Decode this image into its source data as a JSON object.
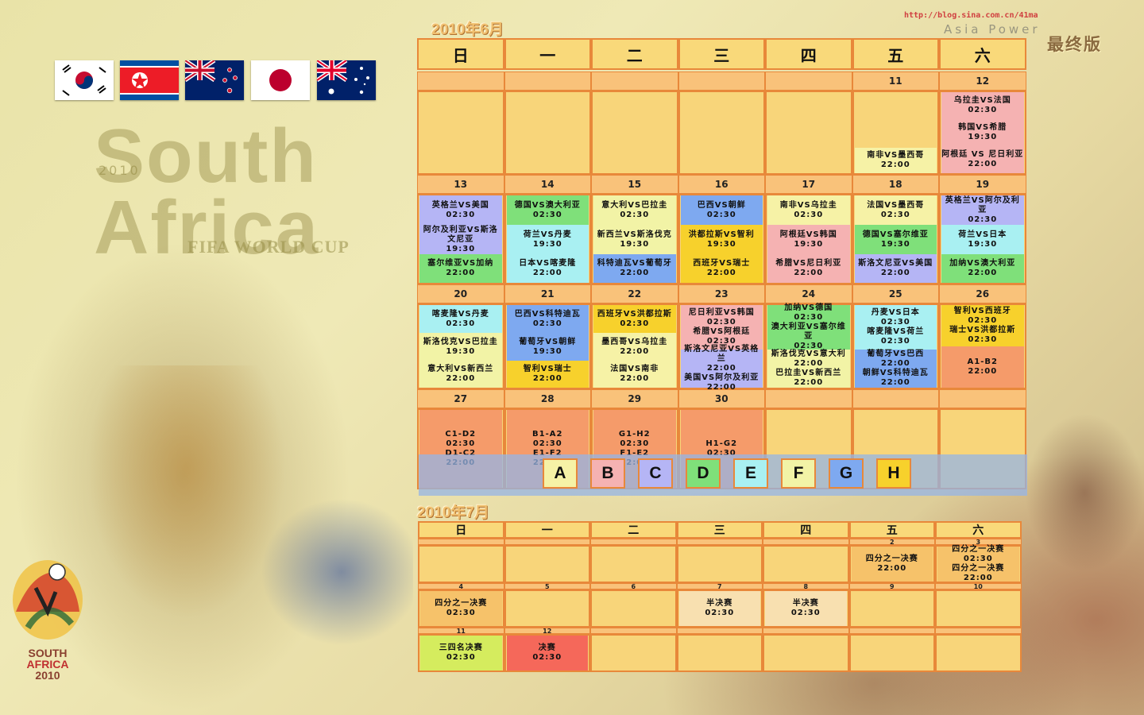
{
  "watermark": {
    "url": "http://blog.sina.com.cn/41ma",
    "brand": "Asia Power",
    "edition": "最终版"
  },
  "flags": [
    "south-korea-flag",
    "north-korea-flag",
    "new-zealand-flag",
    "japan-flag",
    "australia-flag"
  ],
  "branding": {
    "year": "2010",
    "line1": "South",
    "line2": "Africa",
    "cup": "FIFA WORLD CUP",
    "logo_line1": "SOUTH",
    "logo_line2": "AFRICA",
    "logo_line3": "2010"
  },
  "colors": {
    "A": "#f6f2a6",
    "B": "#f5b2b2",
    "C": "#b5b5f5",
    "D": "#7fe07a",
    "E": "#a9f0f2",
    "F": "#f2f3a6",
    "G": "#7ea9f0",
    "H": "#f7d12c",
    "knockout16": "#f59b6a",
    "quarter": "#f6c26a",
    "semi": "#f8e0b0",
    "third": "#d5ec5e",
    "final": "#f5685a",
    "empty": "#f8d57a",
    "border": "#e8883a"
  },
  "june": {
    "title": "2010年6月",
    "weekdays": [
      "日",
      "一",
      "二",
      "三",
      "四",
      "五",
      "六"
    ],
    "weeks": [
      {
        "dates": [
          "",
          "",
          "",
          "",
          "",
          "11",
          "12"
        ],
        "cells": [
          [],
          [],
          [],
          [],
          [],
          [
            {
              "g": "A",
              "t": "南非VS墨西哥",
              "time": "22:00"
            }
          ],
          [
            {
              "g": "B",
              "t": "乌拉圭VS法国",
              "time": "02:30"
            },
            {
              "g": "B",
              "t": "韩国VS希腊",
              "time": "19:30"
            },
            {
              "g": "B",
              "t": "阿根廷 VS 尼日利亚",
              "time": "22:00"
            }
          ]
        ]
      },
      {
        "dates": [
          "13",
          "14",
          "15",
          "16",
          "17",
          "18",
          "19"
        ],
        "cells": [
          [
            {
              "g": "C",
              "t": "英格兰VS美国",
              "time": "02:30"
            },
            {
              "g": "C",
              "t": "阿尔及利亚VS斯洛文尼亚",
              "time": "19:30"
            },
            {
              "g": "D",
              "t": "塞尔维亚VS加纳",
              "time": "22:00"
            }
          ],
          [
            {
              "g": "D",
              "t": "德国VS澳大利亚",
              "time": "02:30"
            },
            {
              "g": "E",
              "t": "荷兰VS丹麦",
              "time": "19:30"
            },
            {
              "g": "E",
              "t": "日本VS喀麦隆",
              "time": "22:00"
            }
          ],
          [
            {
              "g": "F",
              "t": "意大利VS巴拉圭",
              "time": "02:30"
            },
            {
              "g": "F",
              "t": "新西兰VS斯洛伐克",
              "time": "19:30"
            },
            {
              "g": "G",
              "t": "科特迪瓦VS葡萄牙",
              "time": "22:00"
            }
          ],
          [
            {
              "g": "G",
              "t": "巴西VS朝鲜",
              "time": "02:30"
            },
            {
              "g": "H",
              "t": "洪都拉斯VS智利",
              "time": "19:30"
            },
            {
              "g": "H",
              "t": "西班牙VS瑞士",
              "time": "22:00"
            }
          ],
          [
            {
              "g": "A",
              "t": "南非VS乌拉圭",
              "time": "02:30"
            },
            {
              "g": "B",
              "t": "阿根廷VS韩国",
              "time": "19:30"
            },
            {
              "g": "B",
              "t": "希腊VS尼日利亚",
              "time": "22:00"
            }
          ],
          [
            {
              "g": "A",
              "t": "法国VS墨西哥",
              "time": "02:30"
            },
            {
              "g": "D",
              "t": "德国VS塞尔维亚",
              "time": "19:30"
            },
            {
              "g": "C",
              "t": "斯洛文尼亚VS美国",
              "time": "22:00"
            }
          ],
          [
            {
              "g": "C",
              "t": "英格兰VS阿尔及利亚",
              "time": "02:30"
            },
            {
              "g": "E",
              "t": "荷兰VS日本",
              "time": "19:30"
            },
            {
              "g": "D",
              "t": "加纳VS澳大利亚",
              "time": "22:00"
            }
          ]
        ]
      },
      {
        "dates": [
          "20",
          "21",
          "22",
          "23",
          "24",
          "25",
          "26"
        ],
        "cells": [
          [
            {
              "g": "E",
              "t": "喀麦隆VS丹麦",
              "time": "02:30"
            },
            {
              "g": "F",
              "t": "斯洛伐克VS巴拉圭",
              "time": "19:30"
            },
            {
              "g": "F",
              "t": "意大利VS新西兰",
              "time": "22:00"
            }
          ],
          [
            {
              "g": "G",
              "t": "巴西VS科特迪瓦",
              "time": "02:30"
            },
            {
              "g": "G",
              "t": "葡萄牙VS朝鲜",
              "time": "19:30"
            },
            {
              "g": "H",
              "t": "智利VS瑞士",
              "time": "22:00"
            }
          ],
          [
            {
              "g": "H",
              "t": "西班牙VS洪都拉斯",
              "time": "02:30"
            },
            {
              "g": "A",
              "t": "墨西哥VS乌拉圭",
              "time": "22:00"
            },
            {
              "g": "A",
              "t": "法国VS南非",
              "time": "22:00"
            }
          ],
          [
            {
              "g": "B",
              "t": "尼日利亚VS韩国",
              "time": "02:30",
              "t2": "希腊VS阿根廷",
              "time2": "02:30"
            },
            {
              "g": "C",
              "t": "斯洛文尼亚VS英格兰",
              "time": "22:00",
              "t2": "美国VS阿尔及利亚",
              "time2": "22:00"
            }
          ],
          [
            {
              "g": "D",
              "t": "加纳VS德国",
              "time": "02:30",
              "t2": "澳大利亚VS塞尔维亚",
              "time2": "02:30"
            },
            {
              "g": "F",
              "t": "斯洛伐克VS意大利",
              "time": "22:00",
              "t2": "巴拉圭VS新西兰",
              "time2": "22:00"
            }
          ],
          [
            {
              "g": "E",
              "t": "丹麦VS日本",
              "time": "02:30",
              "t2": "喀麦隆VS荷兰",
              "time2": "02:30"
            },
            {
              "g": "G",
              "t": "葡萄牙VS巴西",
              "time": "22:00",
              "t2": "朝鲜VS科特迪瓦",
              "time2": "22:00"
            }
          ],
          [
            {
              "g": "H",
              "t": "智利VS西班牙",
              "time": "02:30",
              "t2": "瑞士VS洪都拉斯",
              "time2": "02:30"
            },
            {
              "g": "K",
              "t": "A1-B2",
              "time": "22:00"
            }
          ]
        ]
      },
      {
        "dates": [
          "27",
          "28",
          "29",
          "30",
          "",
          "",
          ""
        ],
        "cells": [
          [
            {
              "g": "K",
              "t": "C1-D2",
              "time": "02:30",
              "t2": "D1-C2",
              "time2": "22:00"
            }
          ],
          [
            {
              "g": "K",
              "t": "B1-A2",
              "time": "02:30",
              "t2": "E1-F2",
              "time2": "22:00"
            }
          ],
          [
            {
              "g": "K",
              "t": "G1-H2",
              "time": "02:30",
              "t2": "F1-E2",
              "time2": "22:00"
            }
          ],
          [
            {
              "g": "K",
              "t": "H1-G2",
              "time": "02:30"
            }
          ],
          [],
          [],
          []
        ]
      }
    ],
    "legend": [
      "A",
      "B",
      "C",
      "D",
      "E",
      "F",
      "G",
      "H"
    ]
  },
  "july": {
    "title": "2010年7月",
    "weekdays": [
      "日",
      "一",
      "二",
      "三",
      "四",
      "五",
      "六"
    ],
    "weeks": [
      {
        "dates": [
          "",
          "",
          "",
          "",
          "",
          "2",
          "3"
        ],
        "cells": [
          [],
          [],
          [],
          [],
          [],
          [
            {
              "g": "KO",
              "t": "四分之一决赛",
              "time": "22:00"
            }
          ],
          [
            {
              "g": "KO",
              "t": "四分之一决赛",
              "time": "02:30",
              "t2": "四分之一决赛",
              "time2": "22:00"
            }
          ]
        ]
      },
      {
        "dates": [
          "4",
          "5",
          "6",
          "7",
          "8",
          "9",
          "10"
        ],
        "cells": [
          [
            {
              "g": "KO",
              "t": "四分之一决赛",
              "time": "02:30"
            }
          ],
          [],
          [],
          [
            {
              "g": "SF",
              "t": "半决赛",
              "time": "02:30"
            }
          ],
          [
            {
              "g": "SF",
              "t": "半决赛",
              "time": "02:30"
            }
          ],
          [],
          []
        ]
      },
      {
        "dates": [
          "11",
          "12",
          "",
          "",
          "",
          "",
          ""
        ],
        "cells": [
          [
            {
              "g": "3",
              "t": "三四名决赛",
              "time": "02:30"
            }
          ],
          [
            {
              "g": "Fin",
              "t": "决赛",
              "time": "02:30"
            }
          ],
          [],
          [],
          [],
          [],
          []
        ]
      }
    ]
  }
}
